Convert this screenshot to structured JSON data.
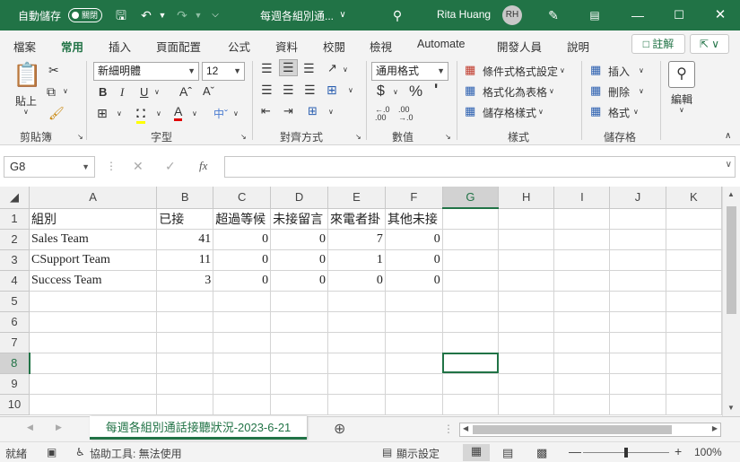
{
  "titlebar": {
    "autosave_label": "自動儲存",
    "autosave_state": "關閉",
    "doc_title": "每週各組別通...",
    "user_name": "Rita Huang",
    "user_initials": "RH"
  },
  "menu": {
    "items": [
      "檔案",
      "常用",
      "插入",
      "頁面配置",
      "公式",
      "資料",
      "校閱",
      "檢視",
      "Automate",
      "開發人員",
      "說明"
    ],
    "active": "常用",
    "comment_label": "註解"
  },
  "ribbon": {
    "clipboard": {
      "paste_label": "貼上",
      "group_label": "剪貼簿"
    },
    "font": {
      "font_name": "新細明體",
      "font_size": "12",
      "group_label": "字型"
    },
    "alignment": {
      "group_label": "對齊方式"
    },
    "number": {
      "format": "通用格式",
      "group_label": "數值"
    },
    "styles": {
      "conditional": "條件式格式設定",
      "as_table": "格式化為表格",
      "cell_styles": "儲存格樣式",
      "group_label": "樣式"
    },
    "cells": {
      "insert": "插入",
      "delete": "刪除",
      "format": "格式",
      "group_label": "儲存格"
    },
    "editing": {
      "label": "編輯"
    }
  },
  "formula_bar": {
    "name_box": "G8",
    "fx": "fx",
    "formula": ""
  },
  "grid": {
    "columns": [
      "A",
      "B",
      "C",
      "D",
      "E",
      "F",
      "G",
      "H",
      "I",
      "J",
      "K"
    ],
    "selected_column": "G",
    "selected_row": "8",
    "rows": [
      {
        "n": "1",
        "cells": [
          "組別",
          "已接",
          "超過等候",
          "未接留言",
          "來電者掛",
          "其他未接",
          "",
          "",
          "",
          "",
          ""
        ]
      },
      {
        "n": "2",
        "cells": [
          "Sales Team",
          "41",
          "0",
          "0",
          "7",
          "0",
          "",
          "",
          "",
          "",
          ""
        ]
      },
      {
        "n": "3",
        "cells": [
          "CSupport Team",
          "11",
          "0",
          "0",
          "1",
          "0",
          "",
          "",
          "",
          "",
          ""
        ]
      },
      {
        "n": "4",
        "cells": [
          "Success Team",
          "3",
          "0",
          "0",
          "0",
          "0",
          "",
          "",
          "",
          "",
          ""
        ]
      },
      {
        "n": "5",
        "cells": [
          "",
          "",
          "",
          "",
          "",
          "",
          "",
          "",
          "",
          "",
          ""
        ]
      },
      {
        "n": "6",
        "cells": [
          "",
          "",
          "",
          "",
          "",
          "",
          "",
          "",
          "",
          "",
          ""
        ]
      },
      {
        "n": "7",
        "cells": [
          "",
          "",
          "",
          "",
          "",
          "",
          "",
          "",
          "",
          "",
          ""
        ]
      },
      {
        "n": "8",
        "cells": [
          "",
          "",
          "",
          "",
          "",
          "",
          "",
          "",
          "",
          "",
          ""
        ]
      },
      {
        "n": "9",
        "cells": [
          "",
          "",
          "",
          "",
          "",
          "",
          "",
          "",
          "",
          "",
          ""
        ]
      },
      {
        "n": "10",
        "cells": [
          "",
          "",
          "",
          "",
          "",
          "",
          "",
          "",
          "",
          "",
          ""
        ]
      }
    ]
  },
  "sheet_tab": "每週各組別通話接聽狀況-2023-6-21",
  "status": {
    "ready": "就緒",
    "accessibility": "協助工具: 無法使用",
    "display_settings": "顯示設定",
    "zoom": "100%"
  },
  "colors": {
    "accent": "#217346"
  }
}
